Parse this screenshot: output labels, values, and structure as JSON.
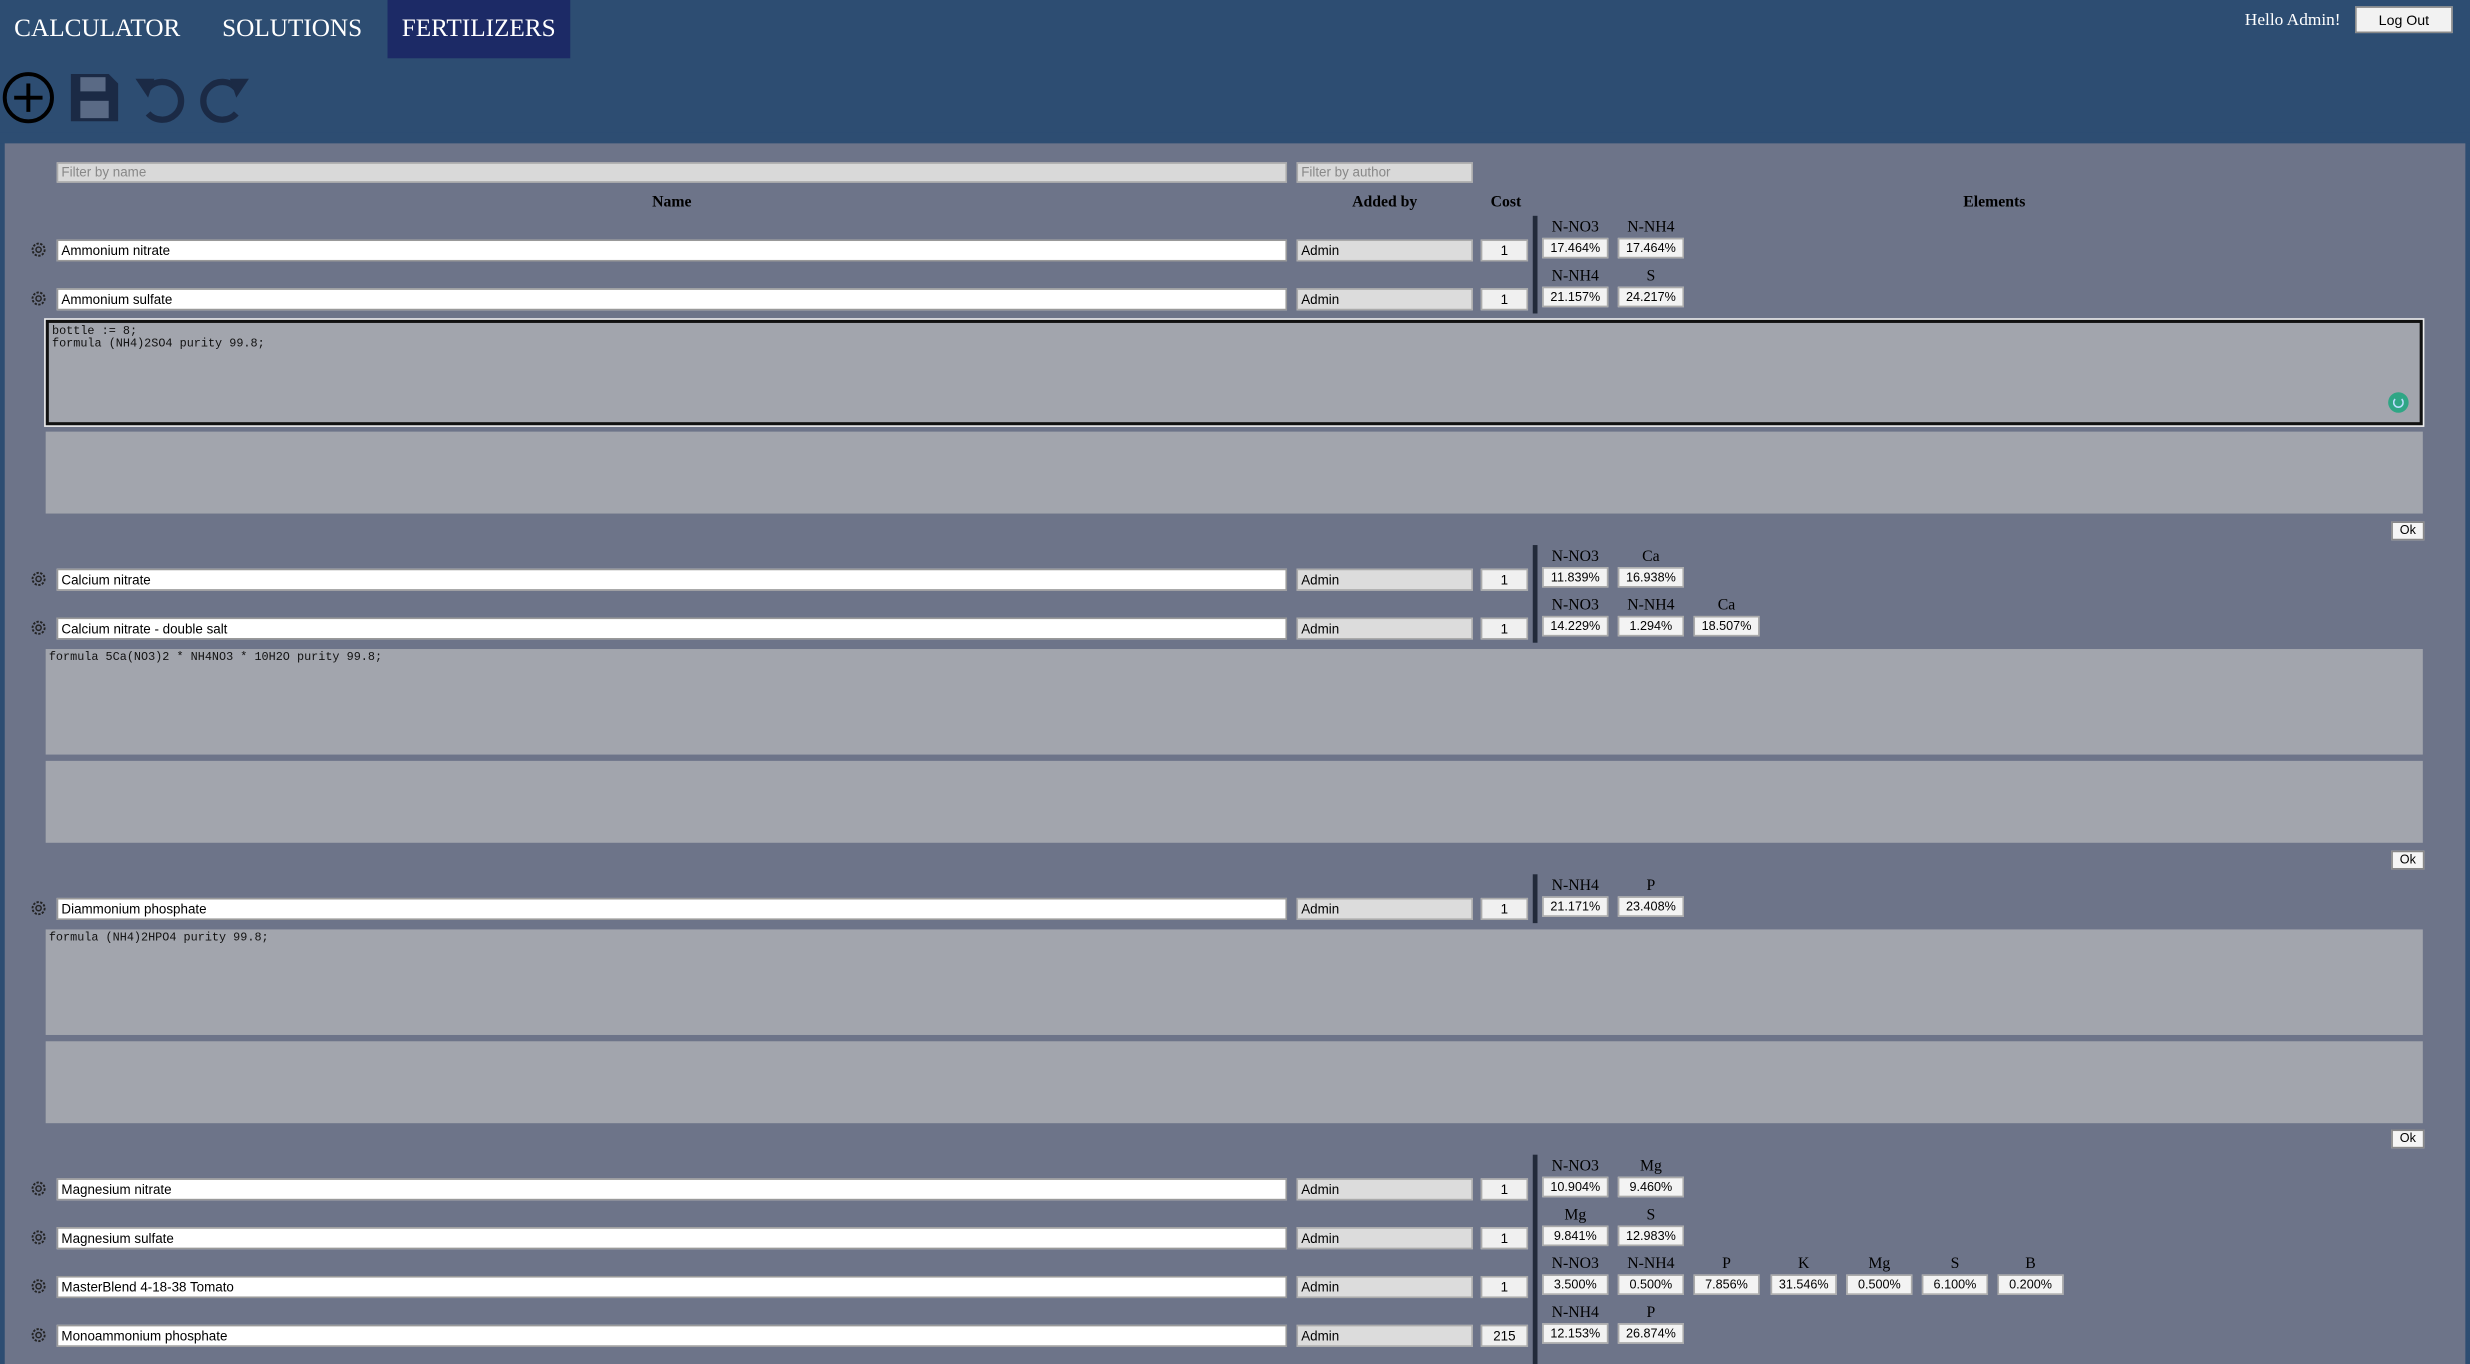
{
  "nav": {
    "tabs": [
      {
        "label": "CALCULATOR"
      },
      {
        "label": "SOLUTIONS"
      },
      {
        "label": "FERTILIZERS"
      }
    ],
    "greeting": "Hello Admin!",
    "logout_label": "Log Out"
  },
  "toolbar": {
    "icons": [
      "add-icon",
      "save-icon",
      "undo-icon",
      "redo-icon"
    ]
  },
  "filters": {
    "name_placeholder": "Filter by name",
    "author_placeholder": "Filter by author"
  },
  "columns": {
    "name": "Name",
    "added_by": "Added by",
    "cost": "Cost",
    "elements": "Elements"
  },
  "rows": [
    {
      "name": "Ammonium nitrate",
      "author": "Admin",
      "cost": "1",
      "elements": [
        {
          "n": "N-NO3",
          "v": "17.464%"
        },
        {
          "n": "N-NH4",
          "v": "17.464%"
        }
      ]
    },
    {
      "name": "Ammonium sulfate",
      "author": "Admin",
      "cost": "1",
      "elements": [
        {
          "n": "N-NH4",
          "v": "21.157%"
        },
        {
          "n": "S",
          "v": "24.217%"
        }
      ]
    },
    {
      "name": "Calcium nitrate",
      "author": "Admin",
      "cost": "1",
      "elements": [
        {
          "n": "N-NO3",
          "v": "11.839%"
        },
        {
          "n": "Ca",
          "v": "16.938%"
        }
      ]
    },
    {
      "name": "Calcium nitrate - double salt",
      "author": "Admin",
      "cost": "1",
      "elements": [
        {
          "n": "N-NO3",
          "v": "14.229%"
        },
        {
          "n": "N-NH4",
          "v": "1.294%"
        },
        {
          "n": "Ca",
          "v": "18.507%"
        }
      ]
    },
    {
      "name": "Diammonium phosphate",
      "author": "Admin",
      "cost": "1",
      "elements": [
        {
          "n": "N-NH4",
          "v": "21.171%"
        },
        {
          "n": "P",
          "v": "23.408%"
        }
      ]
    },
    {
      "name": "Magnesium nitrate",
      "author": "Admin",
      "cost": "1",
      "elements": [
        {
          "n": "N-NO3",
          "v": "10.904%"
        },
        {
          "n": "Mg",
          "v": "9.460%"
        }
      ]
    },
    {
      "name": "Magnesium sulfate",
      "author": "Admin",
      "cost": "1",
      "elements": [
        {
          "n": "Mg",
          "v": "9.841%"
        },
        {
          "n": "S",
          "v": "12.983%"
        }
      ]
    },
    {
      "name": "MasterBlend 4-18-38 Tomato",
      "author": "Admin",
      "cost": "1",
      "elements": [
        {
          "n": "N-NO3",
          "v": "3.500%"
        },
        {
          "n": "N-NH4",
          "v": "0.500%"
        },
        {
          "n": "P",
          "v": "7.856%"
        },
        {
          "n": "K",
          "v": "31.546%"
        },
        {
          "n": "Mg",
          "v": "0.500%"
        },
        {
          "n": "S",
          "v": "6.100%"
        },
        {
          "n": "B",
          "v": "0.200%"
        }
      ]
    },
    {
      "name": "Monoammonium phosphate",
      "author": "Admin",
      "cost": "215",
      "elements": [
        {
          "n": "N-NH4",
          "v": "12.153%"
        },
        {
          "n": "P",
          "v": "26.874%"
        }
      ]
    }
  ],
  "editors": [
    {
      "code": "bottle := 8;\nformula (NH4)2SO4 purity 99.8;",
      "ok_label": "Ok"
    },
    {
      "code": "formula 5Ca(NO3)2 * NH4NO3 * 10H2O purity 99.8;",
      "ok_label": "Ok"
    },
    {
      "code": "formula (NH4)2HPO4 purity 99.8;",
      "ok_label": "Ok"
    }
  ]
}
